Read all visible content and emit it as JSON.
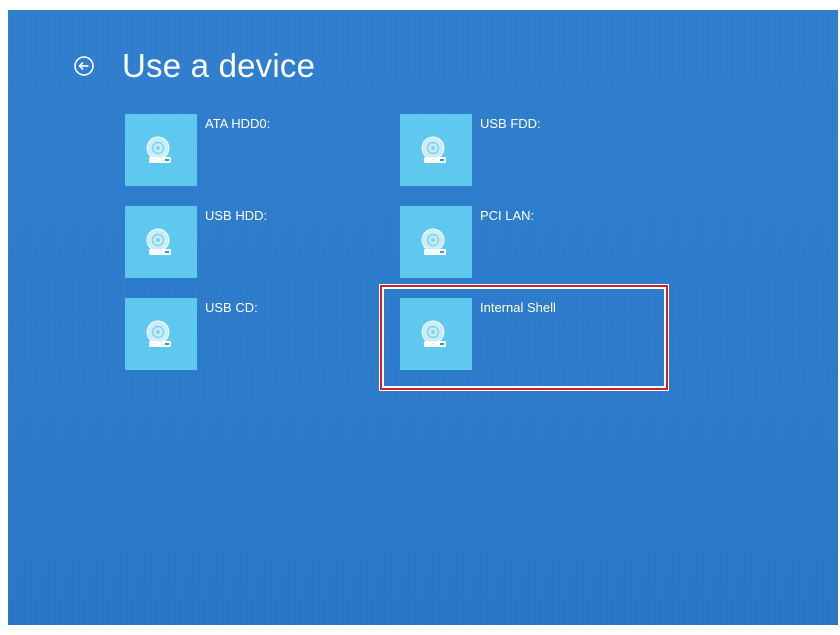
{
  "header": {
    "back_icon": "back-arrow-circle-icon",
    "title": "Use a device"
  },
  "devices": [
    {
      "label": "ATA HDD0:",
      "icon": "disk-drive-icon"
    },
    {
      "label": "USB FDD:",
      "icon": "disk-drive-icon"
    },
    {
      "label": "USB HDD:",
      "icon": "disk-drive-icon"
    },
    {
      "label": "PCI LAN:",
      "icon": "disk-drive-icon"
    },
    {
      "label": "USB CD:",
      "icon": "disk-drive-icon"
    },
    {
      "label": "Internal Shell",
      "icon": "disk-drive-icon",
      "selected": true
    }
  ],
  "colors": {
    "background": "#2c7bcc",
    "tile": "#5ec8ef",
    "selection": "#c8242c",
    "text": "#ffffff"
  }
}
